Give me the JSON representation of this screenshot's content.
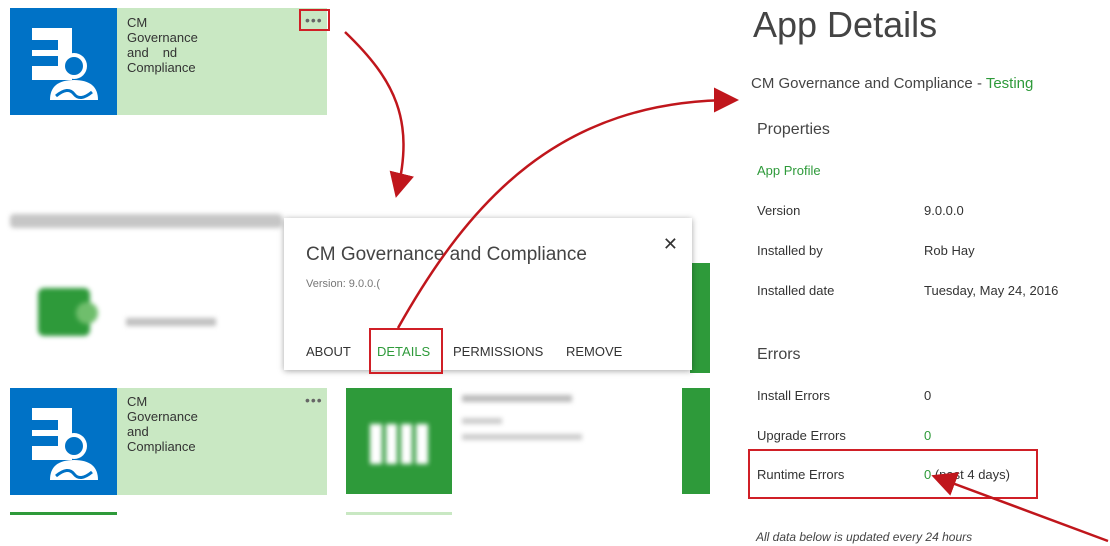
{
  "tiles": {
    "top": {
      "title_line1": "CM Governance and",
      "title_line2": "Compliance",
      "overflow_text": "nd",
      "more_label": "•••"
    },
    "bottom": {
      "title_line1": "CM Governance and",
      "title_line2": "Compliance",
      "more_label": "•••"
    }
  },
  "callout": {
    "title": "CM Governance and Compliance",
    "version": "Version: 9.0.0.(",
    "close_label": "✕",
    "actions": [
      "ABOUT",
      "DETAILS",
      "PERMISSIONS",
      "REMOVE"
    ]
  },
  "details": {
    "title": "App Details",
    "app_name": "CM Governance and Compliance",
    "separator": " - ",
    "status": "Testing",
    "properties_heading": "Properties",
    "app_profile_link": "App Profile",
    "properties": [
      {
        "label": "Version",
        "value": "9.0.0.0"
      },
      {
        "label": "Installed by",
        "value": "Rob Hay"
      },
      {
        "label": "Installed date",
        "value": "Tuesday, May 24, 2016"
      }
    ],
    "errors_heading": "Errors",
    "errors": [
      {
        "label": "Install Errors",
        "value": "0",
        "suffix": ""
      },
      {
        "label": "Upgrade Errors",
        "value": "0",
        "suffix": ""
      },
      {
        "label": "Runtime Errors",
        "value": "0",
        "suffix": " (past 4 days)"
      }
    ],
    "note": "All data below is updated every 24 hours"
  },
  "colors": {
    "brand_blue": "#0072c6",
    "accent_green": "#2e9a3a",
    "annotation_red": "#d01f26"
  }
}
